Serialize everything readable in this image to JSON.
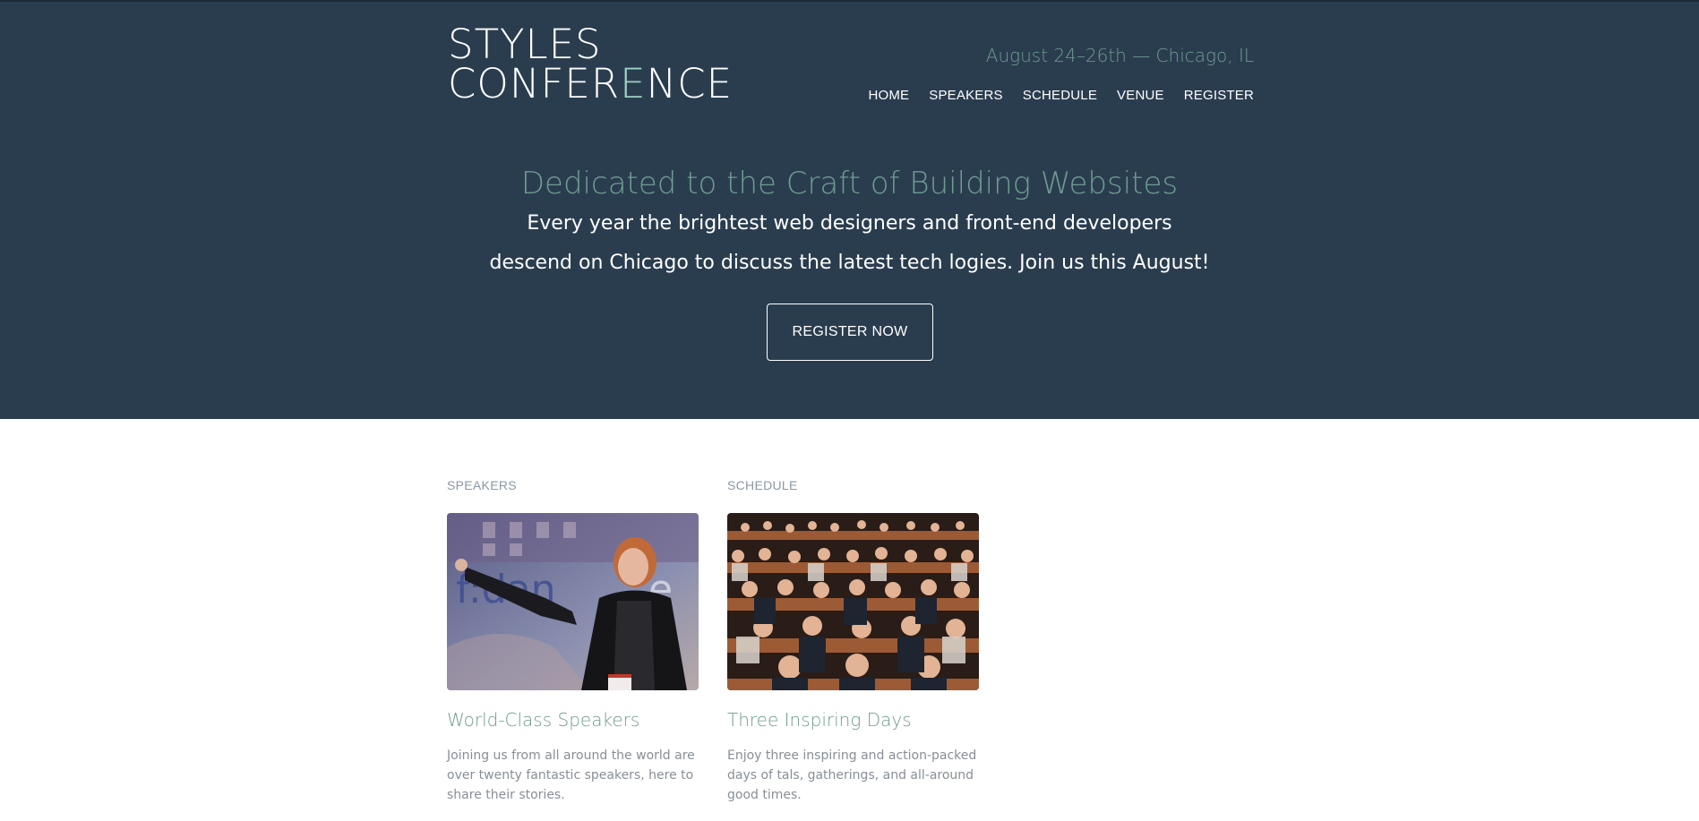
{
  "header": {
    "logo_line1": "STYLES",
    "logo_line2_a": "CONFER",
    "logo_line2_b": "E",
    "logo_line2_c": "NCE",
    "dates": "August 24–26th — Chicago, IL",
    "nav": [
      "HOME",
      "SPEAKERS",
      "SCHEDULE",
      "VENUE",
      "REGISTER"
    ]
  },
  "hero": {
    "tagline": "Dedicated to the Craft of Building Websites",
    "lead": "Every year the brightest web designers and front-end developers descend on Chicago to discuss the latest tech logies. Join us this August!",
    "cta": "REGISTER NOW"
  },
  "sections": [
    {
      "kicker": "SPEAKERS",
      "title": "World-Class Speakers",
      "text": "Joining us from all around the world are over twenty fantastic speakers, here to share their stories.",
      "image_label": "speaker-photo"
    },
    {
      "kicker": "SCHEDULE",
      "title": "Three Inspiring Days",
      "text": "Enjoy three inspiring and action-packed days of tals, gatherings, and all-around good times.",
      "image_label": "audience-photo"
    }
  ],
  "colors": {
    "hero_bg": "#2a3d4f",
    "accent": "#6e9c8f",
    "text_muted": "#888f96"
  }
}
